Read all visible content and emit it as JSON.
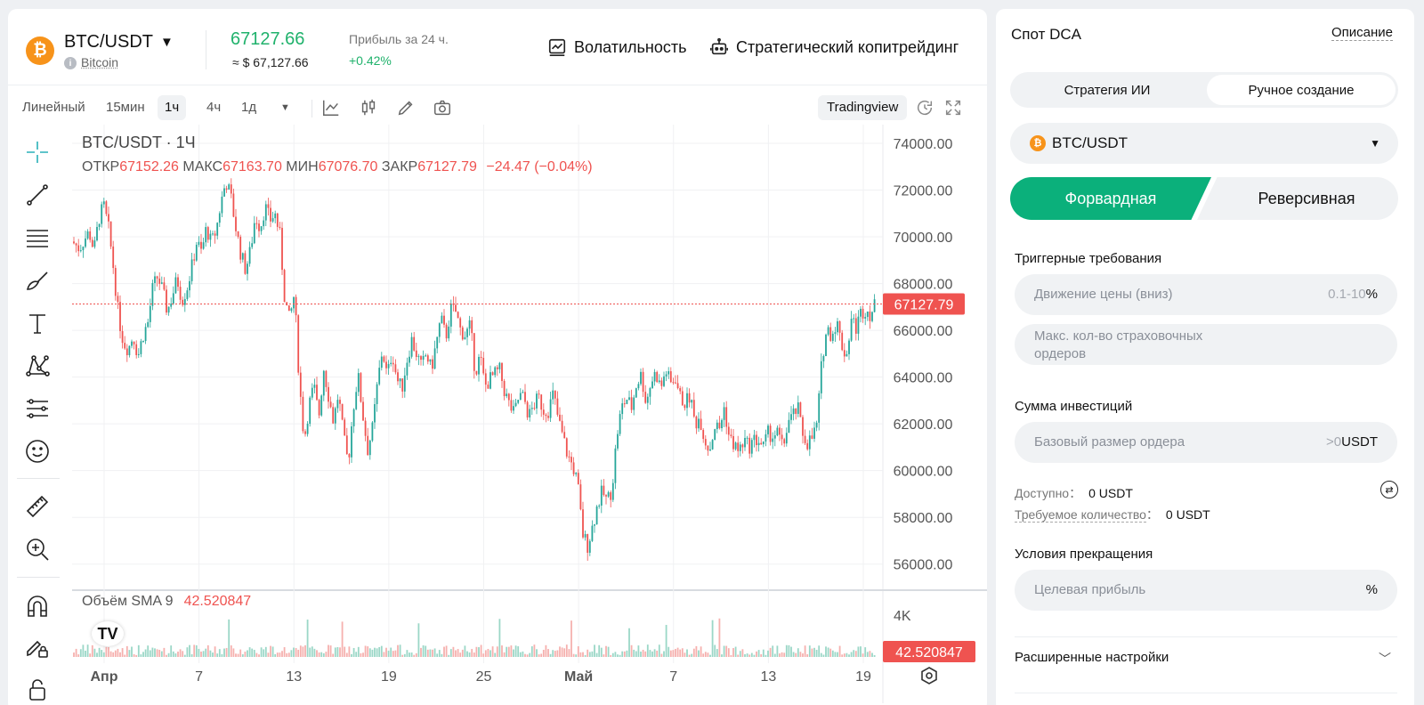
{
  "header": {
    "pair": "BTC/USDT",
    "coin_symbol": "₿",
    "coin_name": "Bitcoin",
    "price": "67127.66",
    "price_usd": "≈ $ 67,127.66",
    "pnl_label": "Прибыль за 24 ч.",
    "pnl_value": "+0.42%",
    "volatility_label": "Волатильность",
    "copytrading_label": "Стратегический копитрейдинг"
  },
  "toolbar": {
    "intervals": [
      "Линейный",
      "15мин",
      "1ч",
      "4ч",
      "1д"
    ],
    "active_interval": "1ч",
    "tradingview_label": "Tradingview",
    "icons": [
      "caret-down-icon",
      "indicators-icon",
      "candles-icon",
      "pencil-icon",
      "camera-icon",
      "reload-icon",
      "fullscreen-icon"
    ]
  },
  "drawing_tools": [
    "crosshair-icon",
    "trendline-icon",
    "horizontal-lines-icon",
    "brush-icon",
    "text-icon",
    "pattern-icon",
    "fib-icon",
    "emoji-icon",
    "ruler-icon",
    "zoom-in-icon",
    "magnet-icon",
    "lock-pencil-icon",
    "lock-icon"
  ],
  "chart": {
    "title": "BTC/USDT · 1Ч",
    "ohlc": {
      "open_label": "ОТКР",
      "open": "67152.26",
      "high_label": "МАКС",
      "high": "67163.70",
      "low_label": "МИН",
      "low": "67076.70",
      "close_label": "ЗАКР",
      "close": "67127.79",
      "change": "−24.47 (−0.04%)"
    },
    "volume_label": "Объём SMA 9",
    "volume_value": "42.520847",
    "colors": {
      "up": "#26a69a",
      "down": "#ef5350",
      "grid": "#f0f1f3"
    }
  },
  "chart_data": {
    "type": "candlestick",
    "title": "BTC/USDT · 1Ч",
    "ylim": [
      55000,
      74800
    ],
    "y_ticks": [
      "74000.00",
      "72000.00",
      "70000.00",
      "68000.00",
      "66000.00",
      "64000.00",
      "62000.00",
      "60000.00",
      "58000.00",
      "56000.00"
    ],
    "x_ticks": [
      "Апр",
      "7",
      "13",
      "19",
      "25",
      "Май",
      "7",
      "13",
      "19"
    ],
    "last_price_label": "67127.79",
    "last_price": 67127.79,
    "volume_axis_tick": "4K",
    "volume_last_label": "42.520847",
    "price_path": [
      [
        0,
        69800
      ],
      [
        3,
        69500
      ],
      [
        5,
        69900
      ],
      [
        7,
        70200
      ],
      [
        9,
        69400
      ],
      [
        11,
        70800
      ],
      [
        13,
        71300
      ],
      [
        15,
        70300
      ],
      [
        17,
        68600
      ],
      [
        19,
        66600
      ],
      [
        21,
        65500
      ],
      [
        23,
        65200
      ],
      [
        25,
        65800
      ],
      [
        27,
        64900
      ],
      [
        29,
        65800
      ],
      [
        31,
        66300
      ],
      [
        33,
        67800
      ],
      [
        35,
        68300
      ],
      [
        37,
        67700
      ],
      [
        39,
        66800
      ],
      [
        41,
        67500
      ],
      [
        43,
        68200
      ],
      [
        45,
        67300
      ],
      [
        47,
        67800
      ],
      [
        49,
        68700
      ],
      [
        51,
        69800
      ],
      [
        53,
        69300
      ],
      [
        55,
        70400
      ],
      [
        57,
        69700
      ],
      [
        59,
        70300
      ],
      [
        61,
        71500
      ],
      [
        63,
        72400
      ],
      [
        65,
        71700
      ],
      [
        67,
        70400
      ],
      [
        69,
        69300
      ],
      [
        71,
        68600
      ],
      [
        73,
        69400
      ],
      [
        75,
        70900
      ],
      [
        77,
        70400
      ],
      [
        79,
        71300
      ],
      [
        81,
        70700
      ],
      [
        83,
        71000
      ],
      [
        85,
        70100
      ],
      [
        87,
        67400
      ],
      [
        89,
        66400
      ],
      [
        91,
        67600
      ],
      [
        93,
        63800
      ],
      [
        95,
        61300
      ],
      [
        97,
        62800
      ],
      [
        99,
        63600
      ],
      [
        101,
        62300
      ],
      [
        103,
        64400
      ],
      [
        105,
        63200
      ],
      [
        107,
        62100
      ],
      [
        109,
        63300
      ],
      [
        111,
        61500
      ],
      [
        113,
        60300
      ],
      [
        115,
        62600
      ],
      [
        117,
        64100
      ],
      [
        119,
        62400
      ],
      [
        121,
        60900
      ],
      [
        123,
        61800
      ],
      [
        125,
        63700
      ],
      [
        127,
        65200
      ],
      [
        129,
        64000
      ],
      [
        131,
        65100
      ],
      [
        133,
        63900
      ],
      [
        135,
        63500
      ],
      [
        137,
        64700
      ],
      [
        139,
        65600
      ],
      [
        141,
        65000
      ],
      [
        143,
        64400
      ],
      [
        145,
        65000
      ],
      [
        147,
        64300
      ],
      [
        149,
        65400
      ],
      [
        151,
        66500
      ],
      [
        153,
        65700
      ],
      [
        155,
        66900
      ],
      [
        157,
        66800
      ],
      [
        159,
        66000
      ],
      [
        161,
        65800
      ],
      [
        163,
        66200
      ],
      [
        165,
        64200
      ],
      [
        167,
        64900
      ],
      [
        169,
        63600
      ],
      [
        171,
        63900
      ],
      [
        173,
        64100
      ],
      [
        175,
        64300
      ],
      [
        177,
        63400
      ],
      [
        179,
        62800
      ],
      [
        181,
        62400
      ],
      [
        183,
        63200
      ],
      [
        185,
        63100
      ],
      [
        187,
        62300
      ],
      [
        189,
        62800
      ],
      [
        191,
        63100
      ],
      [
        193,
        62600
      ],
      [
        195,
        62600
      ],
      [
        197,
        63300
      ],
      [
        199,
        62200
      ],
      [
        201,
        61400
      ],
      [
        203,
        60600
      ],
      [
        205,
        60200
      ],
      [
        207,
        59400
      ],
      [
        209,
        57300
      ],
      [
        211,
        56800
      ],
      [
        213,
        57600
      ],
      [
        215,
        58500
      ],
      [
        217,
        59100
      ],
      [
        219,
        58700
      ],
      [
        221,
        59200
      ],
      [
        223,
        61500
      ],
      [
        225,
        62700
      ],
      [
        227,
        63100
      ],
      [
        229,
        62700
      ],
      [
        231,
        63700
      ],
      [
        233,
        64100
      ],
      [
        235,
        62900
      ],
      [
        237,
        63800
      ],
      [
        239,
        64200
      ],
      [
        241,
        63500
      ],
      [
        243,
        64300
      ],
      [
        245,
        63700
      ],
      [
        247,
        64000
      ],
      [
        249,
        63100
      ],
      [
        251,
        62900
      ],
      [
        253,
        63200
      ],
      [
        255,
        62000
      ],
      [
        257,
        62300
      ],
      [
        259,
        61300
      ],
      [
        261,
        60900
      ],
      [
        263,
        61900
      ],
      [
        265,
        61800
      ],
      [
        267,
        62700
      ],
      [
        269,
        61400
      ],
      [
        271,
        61100
      ],
      [
        273,
        60800
      ],
      [
        275,
        61300
      ],
      [
        277,
        61000
      ],
      [
        279,
        61300
      ],
      [
        281,
        61300
      ],
      [
        283,
        61000
      ],
      [
        285,
        61600
      ],
      [
        287,
        61500
      ],
      [
        289,
        61600
      ],
      [
        291,
        60900
      ],
      [
        293,
        62100
      ],
      [
        295,
        62300
      ],
      [
        297,
        62700
      ],
      [
        299,
        61600
      ],
      [
        301,
        61200
      ],
      [
        303,
        61400
      ],
      [
        305,
        62000
      ],
      [
        307,
        64800
      ],
      [
        309,
        66100
      ],
      [
        311,
        65800
      ],
      [
        313,
        66400
      ],
      [
        315,
        65400
      ],
      [
        317,
        64900
      ],
      [
        319,
        66500
      ],
      [
        321,
        66100
      ],
      [
        323,
        66800
      ],
      [
        325,
        66900
      ],
      [
        327,
        66700
      ],
      [
        329,
        67127.79
      ]
    ]
  }
}
